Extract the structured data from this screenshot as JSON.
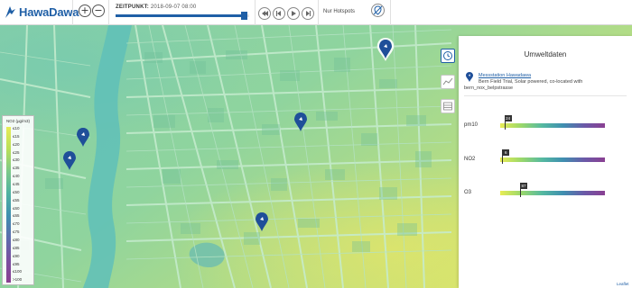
{
  "app": {
    "logo_text": "HawaDawa"
  },
  "header": {
    "zoom_in": "+",
    "zoom_out": "−",
    "zeitpunkt_label": "ZEITPUNKT:",
    "zeitpunkt_value": "2018-09-07 08:00",
    "time_slider_progress": 0.96,
    "hotspots_label": "Nur Hotspots"
  },
  "legend": {
    "title": "NO2 (µg/m3)",
    "ticks": [
      "≤10",
      "≤15",
      "≤20",
      "≤25",
      "≤30",
      "≤35",
      "≤40",
      "≤45",
      "≤50",
      "≤55",
      "≤60",
      "≤65",
      "≤70",
      "≤75",
      "≤80",
      "≤85",
      "≤90",
      "≤95",
      "≤100",
      ">100"
    ]
  },
  "panel": {
    "title": "Umweltdaten",
    "station_name": "Messstation Hawadawa",
    "station_desc": "Bern Field Trial, Solar powered, co-located with",
    "station_desc2": "bern_nox_belpstrasse",
    "metrics": [
      {
        "label": "pm10",
        "value": "24",
        "fraction": 0.04
      },
      {
        "label": "NO2",
        "value": "6",
        "fraction": 0.02
      },
      {
        "label": "O3",
        "value": "87",
        "fraction": 0.19
      }
    ]
  },
  "attribution": "Leaflet",
  "colors": {
    "brand": "#1f5fa6",
    "map_green": "#8fd3a4",
    "map_yellow": "#c9e37a"
  }
}
